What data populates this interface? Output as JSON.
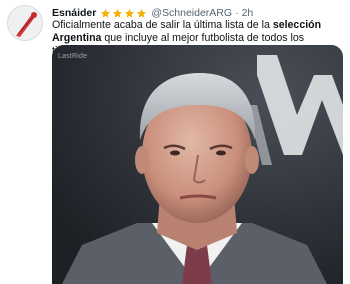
{
  "tweet": {
    "display_name": "Esnáider",
    "handle": "@SchneiderARG",
    "separator": "·",
    "time": "2h",
    "badge_icons": [
      "star-icon",
      "star-icon",
      "star-icon",
      "star-icon"
    ],
    "text_part1": "Oficialmente acaba de salir la última lista de la ",
    "text_bold": "selección Argentina",
    "text_part2": " que incluye al mejor futbolista de todos los tiempos.",
    "media": {
      "watermark": "LastRide",
      "type": "video-frame"
    }
  },
  "colors": {
    "star": "#f4b000",
    "secondary_text": "#536471",
    "primary_text": "#0f1419"
  }
}
